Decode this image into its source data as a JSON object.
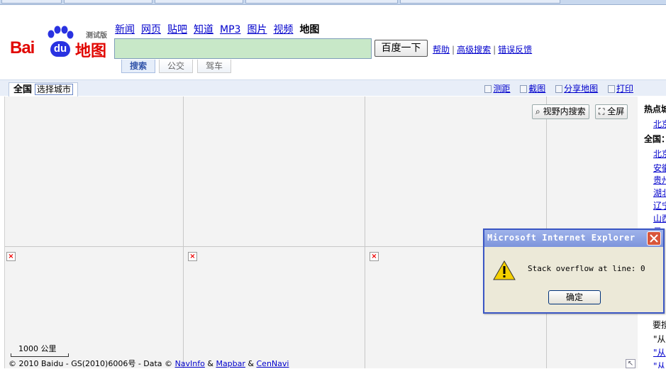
{
  "top_nav": {
    "items": [
      "新闻",
      "网页",
      "贴吧",
      "知道",
      "MP3",
      "图片",
      "视频"
    ],
    "current": "地图"
  },
  "logo": {
    "bai": "Bai",
    "du": "du",
    "ditu": "地图",
    "beta": "测试版"
  },
  "search": {
    "button_label": "百度一下",
    "value": ""
  },
  "links": {
    "help": "帮助",
    "advanced": "高级搜索",
    "report": "错误反馈"
  },
  "modes": {
    "search": "搜索",
    "bus": "公交",
    "drive": "驾车"
  },
  "city": {
    "current": "全国",
    "pick_label": "选择城市"
  },
  "tools": {
    "measure": "测距",
    "screenshot": "截图",
    "share": "分享地图",
    "print": "打印"
  },
  "map": {
    "view_search": "视野内搜索",
    "fullscreen": "全屏",
    "scale_label": "1000 公里",
    "copyright_prefix": "© 2010 Baidu - GS(2010)6006号 - Data ©",
    "src1": "NavInfo",
    "src2": "Mapbar",
    "src3": "CenNavi",
    "amp": "&"
  },
  "side_panel": {
    "hot_heading": "热点城",
    "hot_city": "北京",
    "all_heading": "全国：",
    "cities": [
      "北京",
      "安徽",
      "贵州",
      "湖北",
      "辽宁",
      "山西",
      "云"
    ],
    "hint_heading": "要搜",
    "hint_lines": [
      "\"从",
      "\"从",
      "\"从"
    ]
  },
  "dialog": {
    "title": "Microsoft Internet Explorer",
    "message": "Stack overflow at line: 0",
    "ok_label": "确定"
  },
  "colors": {
    "link": "#0000cc",
    "baidu_red": "#e10601",
    "baidu_blue": "#2932e1",
    "dialog_titlebar": "#7d94dc"
  }
}
